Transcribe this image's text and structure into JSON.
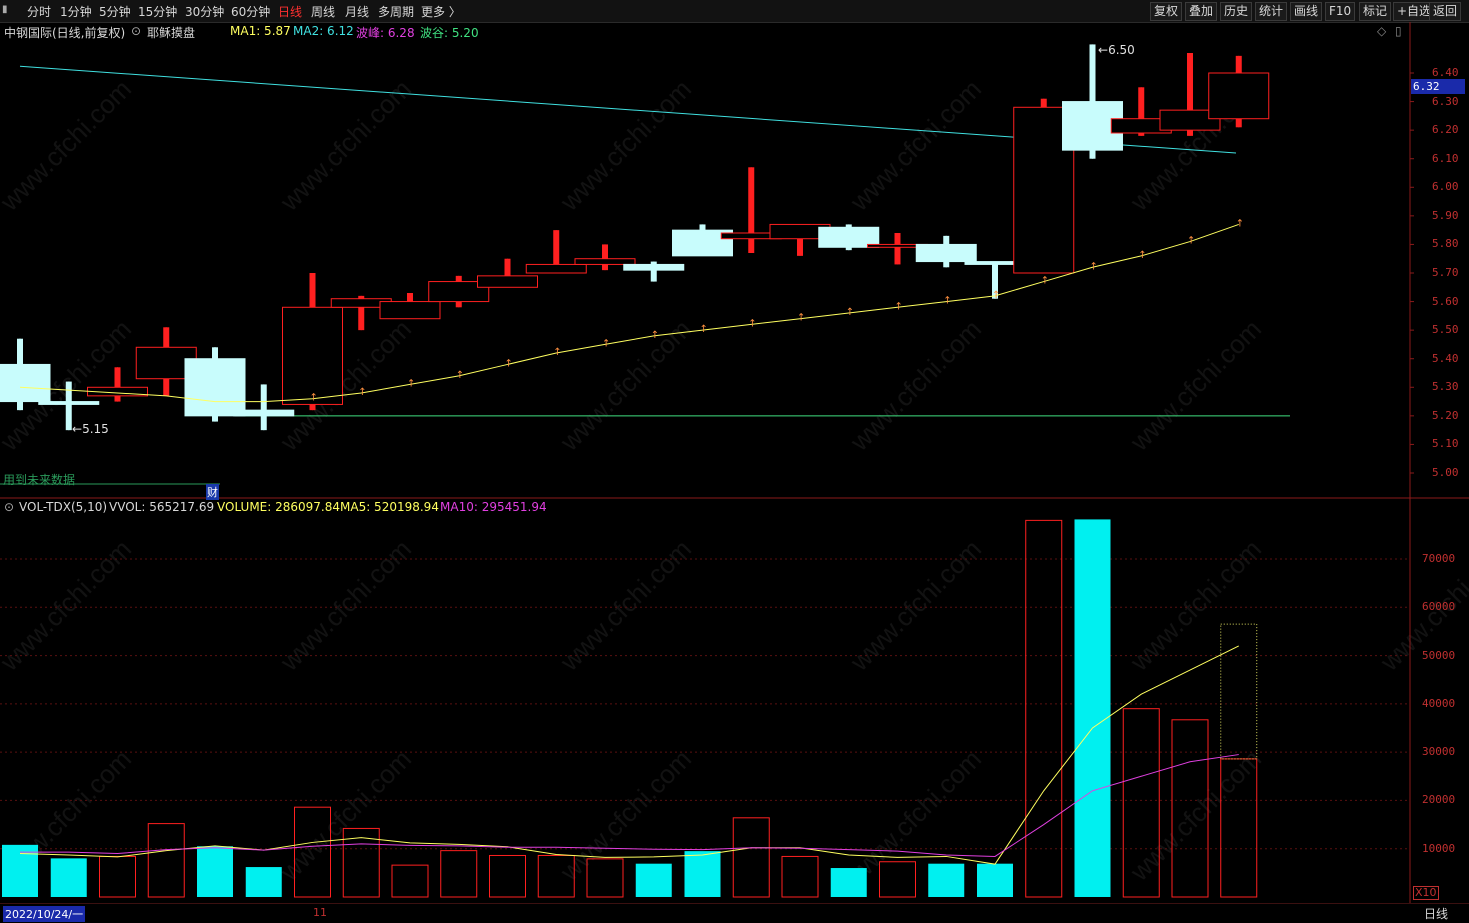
{
  "toolbar": {
    "periods": [
      "分时",
      "1分钟",
      "5分钟",
      "15分钟",
      "30分钟",
      "60分钟",
      "日线",
      "周线",
      "月线",
      "多周期",
      "更多 〉"
    ],
    "active_period": "日线",
    "right_buttons": [
      "复权",
      "叠加",
      "历史",
      "统计",
      "画线",
      "F10",
      "标记",
      "+自选",
      "返回"
    ]
  },
  "chart_header": {
    "stock": "中钢国际(日线,前复权)",
    "template": "耶稣摸盘",
    "ma1": "MA1: 5.87",
    "ma2": "MA2: 6.12",
    "peak": "波峰: 6.28",
    "valley": "波谷: 5.20"
  },
  "price_axis": [
    "6.40",
    "6.30",
    "6.20",
    "6.10",
    "6.00",
    "5.90",
    "5.80",
    "5.70",
    "5.60",
    "5.50",
    "5.40",
    "5.30",
    "5.20",
    "5.10",
    "5.00"
  ],
  "current_price": "6.32",
  "annotations": {
    "high": "6.50",
    "low": "5.15",
    "future_note": "用到未来数据",
    "fin_icon": "财"
  },
  "volume_header": {
    "indicator": "VOL-TDX(5,10)",
    "vvol": "VVOL: 565217.69",
    "volume": "VOLUME: 286097.84",
    "ma5": "MA5: 520198.94",
    "ma10": "MA10: 295451.94"
  },
  "volume_axis": [
    "70000",
    "60000",
    "50000",
    "40000",
    "30000",
    "20000",
    "10000"
  ],
  "volume_unit": "X10",
  "bottom": {
    "date": "2022/10/24/一",
    "month_mark": "11",
    "period_label": "日线"
  },
  "colors": {
    "up": "#ff2020",
    "down": "#c8fcfc",
    "ma1": "#ffff60",
    "ma2": "#40e0e0",
    "ma10": "#e040e0",
    "support": "#40e080"
  },
  "chart_data": {
    "type": "candlestick",
    "price_ylim": [
      5.0,
      6.4
    ],
    "candles": [
      {
        "o": 5.38,
        "h": 5.47,
        "l": 5.22,
        "c": 5.25
      },
      {
        "o": 5.25,
        "h": 5.32,
        "l": 5.15,
        "c": 5.24
      },
      {
        "o": 5.27,
        "h": 5.37,
        "l": 5.25,
        "c": 5.3
      },
      {
        "o": 5.33,
        "h": 5.51,
        "l": 5.27,
        "c": 5.44
      },
      {
        "o": 5.4,
        "h": 5.44,
        "l": 5.18,
        "c": 5.2
      },
      {
        "o": 5.22,
        "h": 5.31,
        "l": 5.15,
        "c": 5.2
      },
      {
        "o": 5.24,
        "h": 5.7,
        "l": 5.22,
        "c": 5.58
      },
      {
        "o": 5.58,
        "h": 5.62,
        "l": 5.5,
        "c": 5.61
      },
      {
        "o": 5.54,
        "h": 5.63,
        "l": 5.54,
        "c": 5.6
      },
      {
        "o": 5.6,
        "h": 5.69,
        "l": 5.58,
        "c": 5.67
      },
      {
        "o": 5.65,
        "h": 5.75,
        "l": 5.65,
        "c": 5.69
      },
      {
        "o": 5.7,
        "h": 5.85,
        "l": 5.7,
        "c": 5.73
      },
      {
        "o": 5.73,
        "h": 5.8,
        "l": 5.71,
        "c": 5.75
      },
      {
        "o": 5.73,
        "h": 5.74,
        "l": 5.67,
        "c": 5.71
      },
      {
        "o": 5.85,
        "h": 5.87,
        "l": 5.76,
        "c": 5.76
      },
      {
        "o": 5.82,
        "h": 6.07,
        "l": 5.77,
        "c": 5.84
      },
      {
        "o": 5.82,
        "h": 5.87,
        "l": 5.76,
        "c": 5.87
      },
      {
        "o": 5.86,
        "h": 5.87,
        "l": 5.78,
        "c": 5.79
      },
      {
        "o": 5.79,
        "h": 5.84,
        "l": 5.73,
        "c": 5.8
      },
      {
        "o": 5.8,
        "h": 5.83,
        "l": 5.72,
        "c": 5.74
      },
      {
        "o": 5.74,
        "h": 5.74,
        "l": 5.61,
        "c": 5.73
      },
      {
        "o": 5.7,
        "h": 6.31,
        "l": 5.7,
        "c": 6.28
      },
      {
        "o": 6.3,
        "h": 6.5,
        "l": 6.1,
        "c": 6.13
      },
      {
        "o": 6.19,
        "h": 6.35,
        "l": 6.18,
        "c": 6.24
      },
      {
        "o": 6.2,
        "h": 6.47,
        "l": 6.18,
        "c": 6.27
      },
      {
        "o": 6.24,
        "h": 6.46,
        "l": 6.21,
        "c": 6.4
      }
    ],
    "ma1": [
      5.3,
      5.29,
      5.28,
      5.27,
      5.25,
      5.25,
      5.26,
      5.28,
      5.31,
      5.34,
      5.38,
      5.42,
      5.45,
      5.48,
      5.5,
      5.52,
      5.54,
      5.56,
      5.58,
      5.6,
      5.62,
      5.67,
      5.72,
      5.76,
      5.81,
      5.87
    ],
    "ma2": {
      "start": 6.42,
      "end": 6.12
    },
    "support": 5.2,
    "volumes": [
      10800,
      8000,
      8400,
      15200,
      10500,
      6200,
      18600,
      14200,
      6600,
      9600,
      8600,
      8600,
      7900,
      6900,
      9500,
      16400,
      8400,
      6000,
      7300,
      6900,
      6900,
      78000,
      78200,
      39000,
      36700,
      28600
    ],
    "ma5": [
      9000,
      8700,
      8300,
      9600,
      10600,
      9700,
      11300,
      12300,
      11200,
      10900,
      10400,
      8800,
      8200,
      8300,
      8700,
      10200,
      10200,
      8700,
      8200,
      8400,
      6800,
      22000,
      35000,
      42000,
      47000,
      52000
    ],
    "ma10": [
      9300,
      9300,
      9000,
      9800,
      10200,
      9700,
      10500,
      11000,
      10700,
      10600,
      10300,
      10300,
      10100,
      9900,
      9800,
      10200,
      10100,
      9800,
      9500,
      8700,
      8400,
      15000,
      22000,
      25000,
      28000,
      29500
    ],
    "vol_ylim": [
      0,
      80000
    ]
  }
}
